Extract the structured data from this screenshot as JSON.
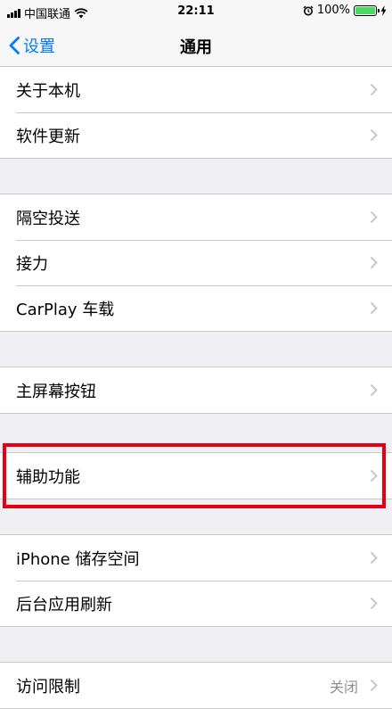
{
  "status_bar": {
    "carrier": "中国联通",
    "time": "22:11",
    "battery": "100%"
  },
  "nav": {
    "back_label": "设置",
    "title": "通用"
  },
  "groups": [
    [
      {
        "label": "关于本机"
      },
      {
        "label": "软件更新"
      }
    ],
    [
      {
        "label": "隔空投送"
      },
      {
        "label": "接力"
      },
      {
        "label": "CarPlay 车载"
      }
    ],
    [
      {
        "label": "主屏幕按钮"
      }
    ],
    [
      {
        "label": "辅助功能"
      }
    ],
    [
      {
        "label": "iPhone 储存空间"
      },
      {
        "label": "后台应用刷新"
      }
    ],
    [
      {
        "label": "访问限制",
        "value": "关闭"
      }
    ]
  ],
  "colors": {
    "accent": "#007aff",
    "highlight": "#e60012",
    "battery": "#4cd964"
  }
}
